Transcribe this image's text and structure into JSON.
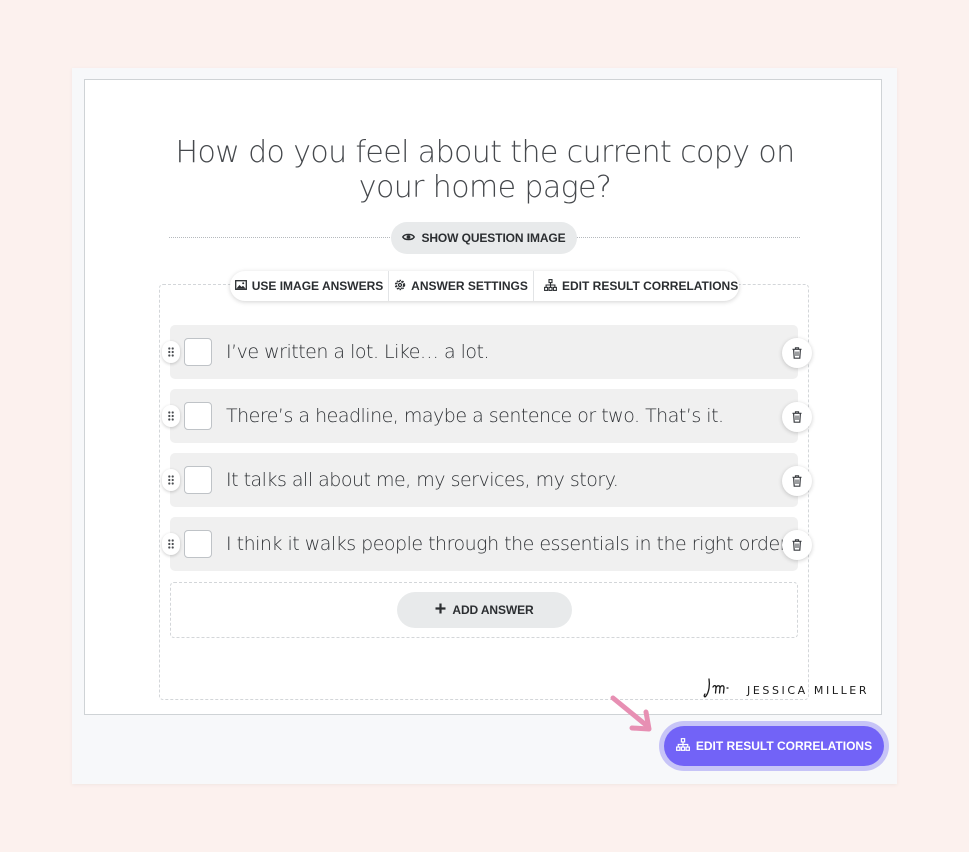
{
  "question": {
    "title": "How do you feel about the current copy on your home page?",
    "show_image_label": "SHOW QUESTION IMAGE"
  },
  "toolbar": {
    "image_answers_label": "USE IMAGE ANSWERS",
    "answer_settings_label": "ANSWER SETTINGS",
    "edit_correlations_label": "EDIT RESULT CORRELATIONS"
  },
  "answers": [
    {
      "text": "I’ve written a lot. Like… a lot."
    },
    {
      "text": "There’s a headline, maybe a sentence or two. That’s it."
    },
    {
      "text": "It talks all about me, my services, my story."
    },
    {
      "text": "I think it walks people through the essentials in the right order."
    }
  ],
  "add_answer_label": "ADD ANSWER",
  "brand": {
    "name": "JESSICA MILLER"
  },
  "footer": {
    "edit_correlations_label": "EDIT RESULT CORRELATIONS"
  },
  "colors": {
    "accent": "#7263f7",
    "accent_ring": "#c7c4f7",
    "arrow": "#e78fb3",
    "background": "#fcf1ee"
  }
}
